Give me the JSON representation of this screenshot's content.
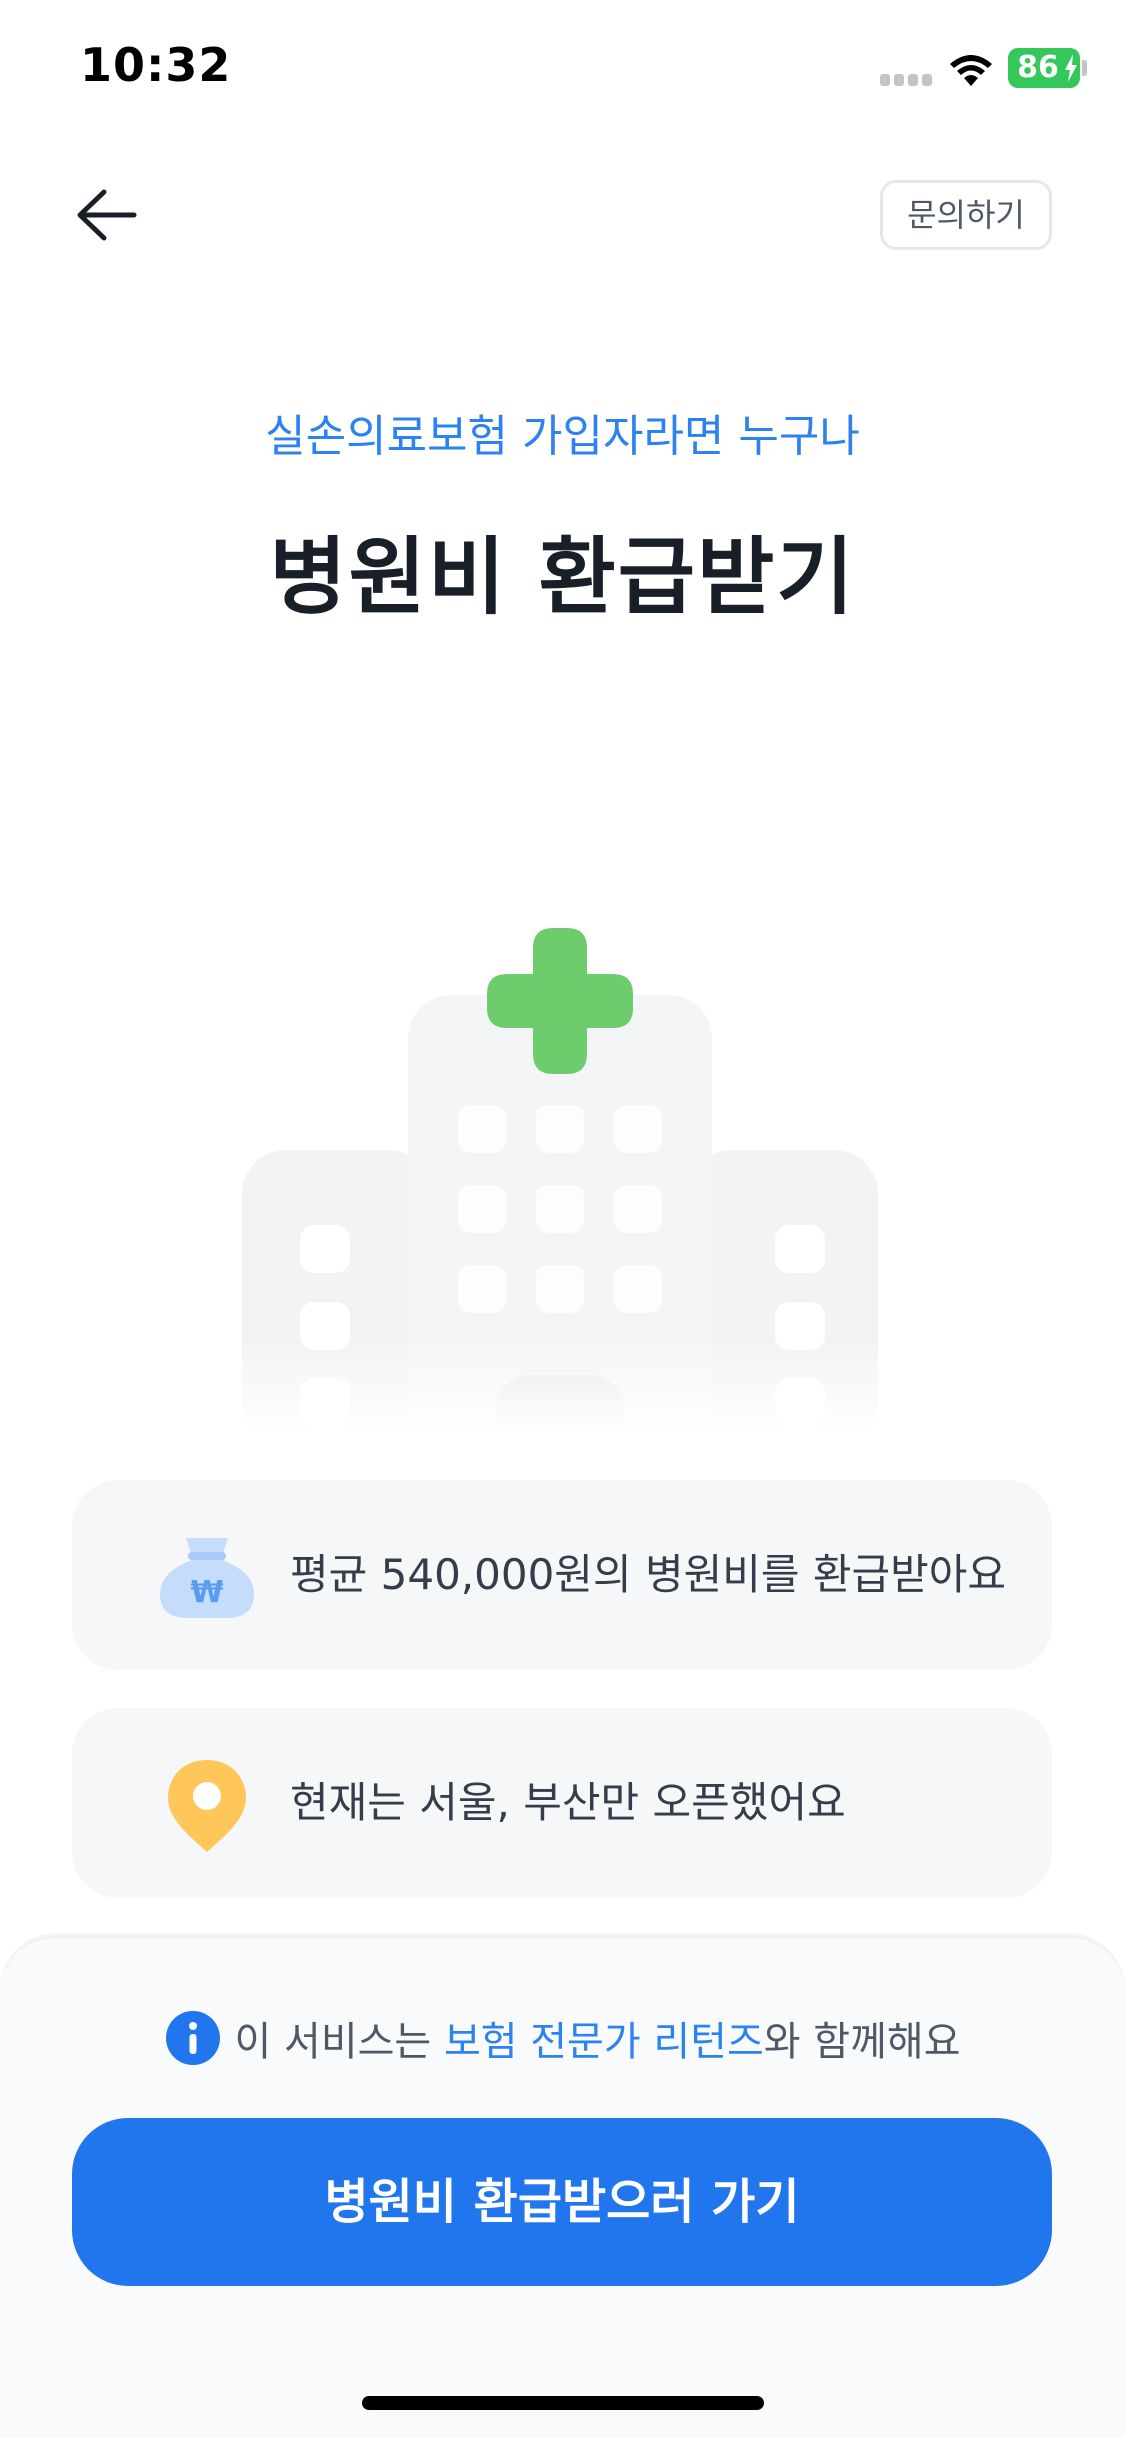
{
  "status_bar": {
    "time": "10:32",
    "battery_level": "86",
    "icons": [
      "signal-icon",
      "wifi-icon",
      "battery-icon"
    ]
  },
  "nav": {
    "back_icon": "arrow-left-icon",
    "inquiry_label": "문의하기"
  },
  "header": {
    "subtitle": "실손의료보험 가입자라면 누구나",
    "title": "병원비 환급받기"
  },
  "illustration": {
    "name": "hospital-illustration",
    "cross_color": "#6dcc6b",
    "building_color": "#f2f3f5"
  },
  "info_cards": [
    {
      "icon": "money-bag-icon",
      "text": "평균 540,000원의 병원비를 환급받아요"
    },
    {
      "icon": "location-pin-icon",
      "text": "현재는 서울, 부산만 오픈했어요"
    }
  ],
  "bottom": {
    "notice_prefix": "이 서비스는 ",
    "notice_highlight": "보험 전문가 리턴즈",
    "notice_suffix": "와 함께해요",
    "notice_icon": "info-icon",
    "cta_label": "병원비 환급받으러 가기"
  },
  "colors": {
    "accent": "#2b82f0",
    "cta": "#2176ed",
    "card_bg": "#f6f7f9",
    "pin": "#ffc75a"
  }
}
